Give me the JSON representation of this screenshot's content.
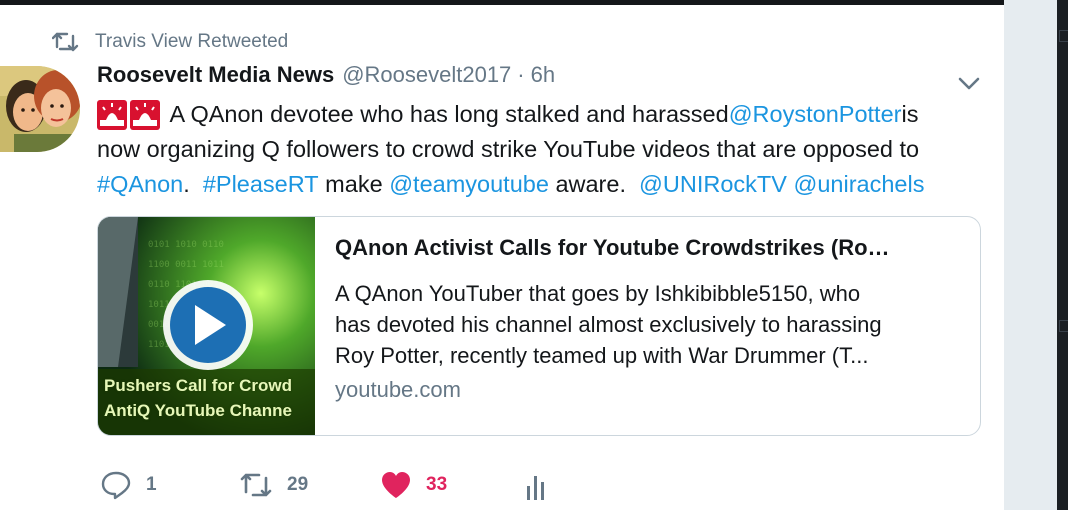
{
  "retweet_context": {
    "text": "Travis View Retweeted"
  },
  "author": {
    "name": "Roosevelt Media News",
    "handle": "@Roosevelt2017",
    "separator": "·",
    "time": "6h"
  },
  "tweet": {
    "emoji": [
      "rotating-light",
      "rotating-light"
    ],
    "line1": {
      "a": "A QAnon devotee who has long stalked and harassed ",
      "mention": "@RoystonPotter",
      "b": " is"
    },
    "line2": "now organizing Q followers to crowd strike YouTube videos that are opposed to",
    "line3": {
      "hashtag1": "#QAnon",
      "sep1": ".  ",
      "hashtag2": "#PleaseRT",
      "sep2": " make ",
      "mention1": "@teamyoutube",
      "sep3": " aware.  ",
      "mention2": "@UNIRockTV",
      "sep4": " ",
      "mention3": "@unirachels"
    }
  },
  "card": {
    "title": "QAnon Activist Calls for Youtube Crowdstrikes (Ro…",
    "description_lines": [
      "A QAnon YouTuber that goes by Ishkibibble5150, who",
      "has devoted his channel almost exclusively to harassing",
      "Roy Potter, recently teamed up with War Drummer (T..."
    ],
    "domain": "youtube.com",
    "thumbnail_caption": [
      "Pushers Call for Crowd",
      "AntiQ YouTube Channe"
    ]
  },
  "actions": {
    "reply_count": "1",
    "retweet_count": "29",
    "like_count": "33",
    "colors": {
      "muted": "#657786",
      "like": "#e0245e",
      "link": "#1b95e0"
    }
  }
}
